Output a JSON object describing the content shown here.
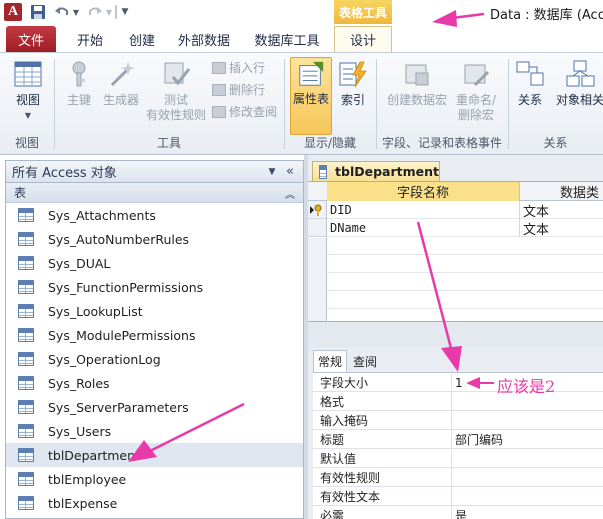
{
  "titlebar": {
    "app_icon_letter": "A",
    "context_tab_group": "表格工具",
    "window_title": "Data : 数据库 (Acces"
  },
  "tabs": {
    "file": "文件",
    "home": "开始",
    "create": "创建",
    "external": "外部数据",
    "dbtools": "数据库工具",
    "design": "设计"
  },
  "ribbon": {
    "view": "视图",
    "primary_key": "主键",
    "builder": "生成器",
    "test_line1": "测试",
    "test_line2": "有效性规则",
    "insert_rows": "插入行",
    "delete_rows": "删除行",
    "modify_lookup": "修改查阅",
    "property_sheet": "属性表",
    "indexes": "索引",
    "create_macro": "创建数据宏",
    "rename_line1": "重命名/",
    "rename_line2": "删除宏",
    "relationships": "关系",
    "object_deps": "对象相关",
    "group_views": "视图",
    "group_tools": "工具",
    "group_showhide": "显示/隐藏",
    "group_events": "字段、记录和表格事件",
    "group_relationships": "关系"
  },
  "nav": {
    "header": "所有 Access 对象",
    "group": "表",
    "items": [
      "Sys_Attachments",
      "Sys_AutoNumberRules",
      "Sys_DUAL",
      "Sys_FunctionPermissions",
      "Sys_LookupList",
      "Sys_ModulePermissions",
      "Sys_OperationLog",
      "Sys_Roles",
      "Sys_ServerParameters",
      "Sys_Users",
      "tblDepartment",
      "tblEmployee",
      "tblExpense"
    ],
    "selected": "tblDepartment"
  },
  "doc_tab": "tblDepartment",
  "grid": {
    "col_name": "字段名称",
    "col_type": "数据类",
    "rows": [
      {
        "name": "DID",
        "type": "文本",
        "key": true
      },
      {
        "name": "DName",
        "type": "文本",
        "key": false
      }
    ]
  },
  "props": {
    "tab_general": "常规",
    "tab_lookup": "查阅",
    "rows": [
      {
        "label": "字段大小",
        "value": "1"
      },
      {
        "label": "格式",
        "value": ""
      },
      {
        "label": "输入掩码",
        "value": ""
      },
      {
        "label": "标题",
        "value": "部门编码"
      },
      {
        "label": "默认值",
        "value": ""
      },
      {
        "label": "有效性规则",
        "value": ""
      },
      {
        "label": "有效性文本",
        "value": ""
      },
      {
        "label": "必需",
        "value": "是"
      }
    ]
  },
  "annotation": {
    "text": "应该是2",
    "color": "#e83aa8"
  }
}
